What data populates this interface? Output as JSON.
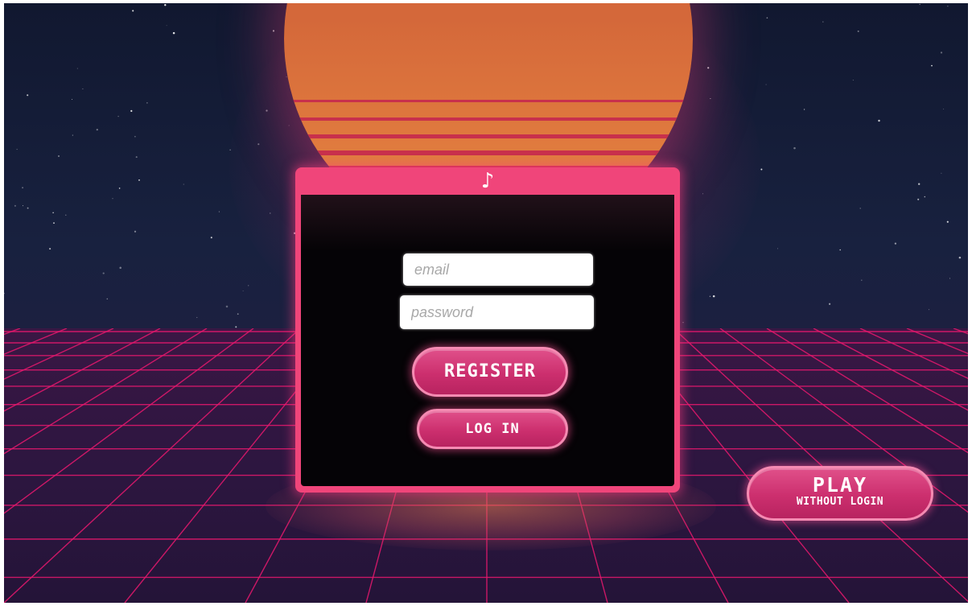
{
  "header": {
    "icon": "music-note-icon",
    "icon_glyph": "♪"
  },
  "form": {
    "email_placeholder": "email",
    "password_placeholder": "password",
    "register_label": "REGISTER",
    "login_label": "LOG IN"
  },
  "guest": {
    "play_label": "PLAY",
    "without_login_label": "WITHOUT LOGIN"
  },
  "colors": {
    "panel_frame": "#f0457a",
    "panel_body": "#050306",
    "button_fill": "#cc2f6e",
    "button_border": "#f58ab2",
    "sun_top": "#d05a38",
    "sun_bottom": "#e38a44",
    "grid_line": "#e8186e",
    "sky": "#18213f"
  }
}
